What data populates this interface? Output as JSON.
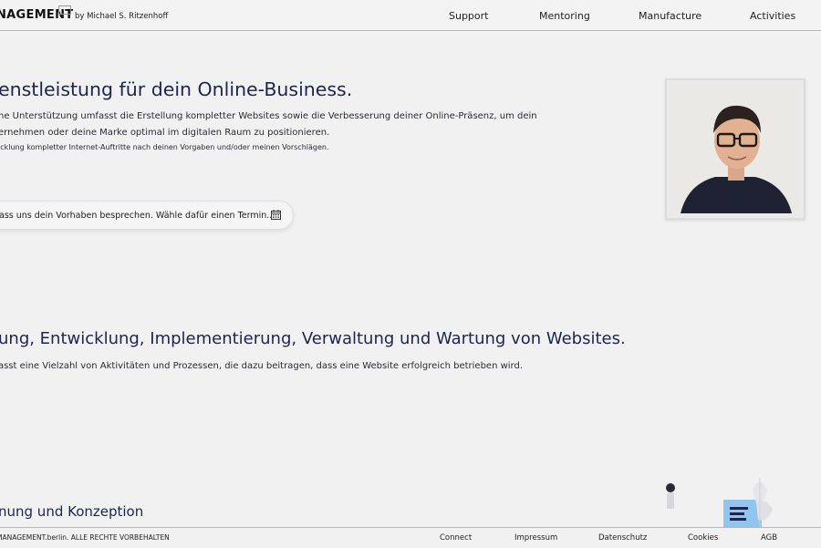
{
  "header": {
    "brand": "NAGEMENT",
    "byline": "by Michael S. Ritzenhoff",
    "nav": [
      "Support",
      "Mentoring",
      "Manufacture",
      "Activities"
    ]
  },
  "hero": {
    "title": "enstleistung für dein Online-Business.",
    "paragraph_line1": "ne Unterstützung umfasst die Erstellung kompletter Websites sowie die Verbesserung deiner Online-Präsenz, um dein",
    "paragraph_line2": "ernehmen oder deine Marke optimal im digitalen Raum zu positionieren.",
    "small": "icklung kompletter Internet-Auftritte nach deinen Vorgaben und/oder meinen Vorschlägen.",
    "cta_label": "ass uns dein Vorhaben besprechen. Wähle dafür einen Termin...",
    "cta_icon": "calendar-icon"
  },
  "section2": {
    "title": "ung, Entwicklung, Implementierung, Verwaltung und Wartung von Websites.",
    "text": "asst eine Vielzahl von Aktivitäten und Prozessen, die dazu beitragen, dass eine Website erfolgreich betrieben wird."
  },
  "section3": {
    "title": "nung und Konzeption"
  },
  "footer": {
    "copyright": "MANAGEMENT.berlin. ALLE RECHTE VORBEHALTEN",
    "links": [
      "Connect",
      "Impressum",
      "Datenschutz",
      "Cookies",
      "AGB"
    ]
  },
  "colors": {
    "background": "#f1f1f2",
    "heading": "#1e2450",
    "accent_blue": "#5aa9e6"
  }
}
